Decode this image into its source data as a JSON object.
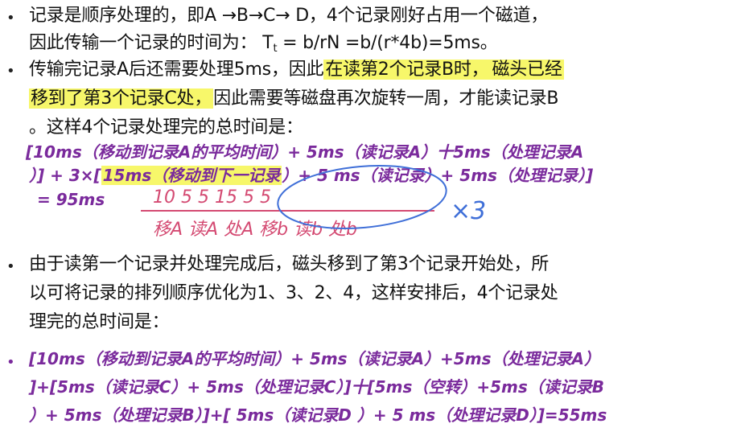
{
  "section1": {
    "line1": "记录是顺序处理的，即A →B→C→ D，4个记录刚好占用一个磁道，",
    "line2_a": "因此传输一个记录的时间为：  T",
    "line2_sub": "t",
    "line2_b": " = b/rN =b/(r*4b)=5ms。"
  },
  "section2": {
    "line1_a": "传输完记录A后还需要处理5ms，因此",
    "line1_hl1": "在读第2个记录B时，",
    "line1_hl2": "磁头已经",
    "line2_hl": "移到了第3个记录C处，",
    "line2_b": "因此需要等磁盘再次旋转一周，才能读记录B",
    "line3": "。这样4个记录处理完的总时间是："
  },
  "formula1": {
    "line1": "[10ms（移动到记录A的平均时间）+ 5ms（读记录A）十5ms（处理记录A",
    "line2_a": "）] + 3×[",
    "line2_hl": "15ms（移动到下一记录",
    "line2_b": "）+ 5 ms（读记录）+ 5ms（处理记录）]",
    "line3": "= 95ms"
  },
  "handwriting": {
    "numbers": "10   5   5   15   5   5",
    "words": "移A  读A 处A  移b  读b 处b",
    "times": "×3"
  },
  "section3": {
    "line1": "由于读第一个记录并处理完成后，磁头移到了第3个记录开始处，所",
    "line2": "以可将记录的排列顺序优化为1、3、2、4，这样安排后，4个记录处",
    "line3": "理完的总时间是："
  },
  "formula2": {
    "line1": "[10ms（移动到记录A的平均时间）+ 5ms（读记录A）+5ms（处理记录A）",
    "line2": "]+[5ms（读记录C）+ 5ms（处理记录C）]十[5ms（空转）+5ms（读记录B",
    "line3": "）+ 5ms（处理记录B）]+[ 5ms（读记录D ）+ 5 ms（处理记录D）]=55ms"
  },
  "colors": {
    "purple": "#7a2a9c",
    "highlight": "#f7f76a",
    "ink_pink": "#d44a72",
    "ink_blue": "#3f6fd8"
  }
}
